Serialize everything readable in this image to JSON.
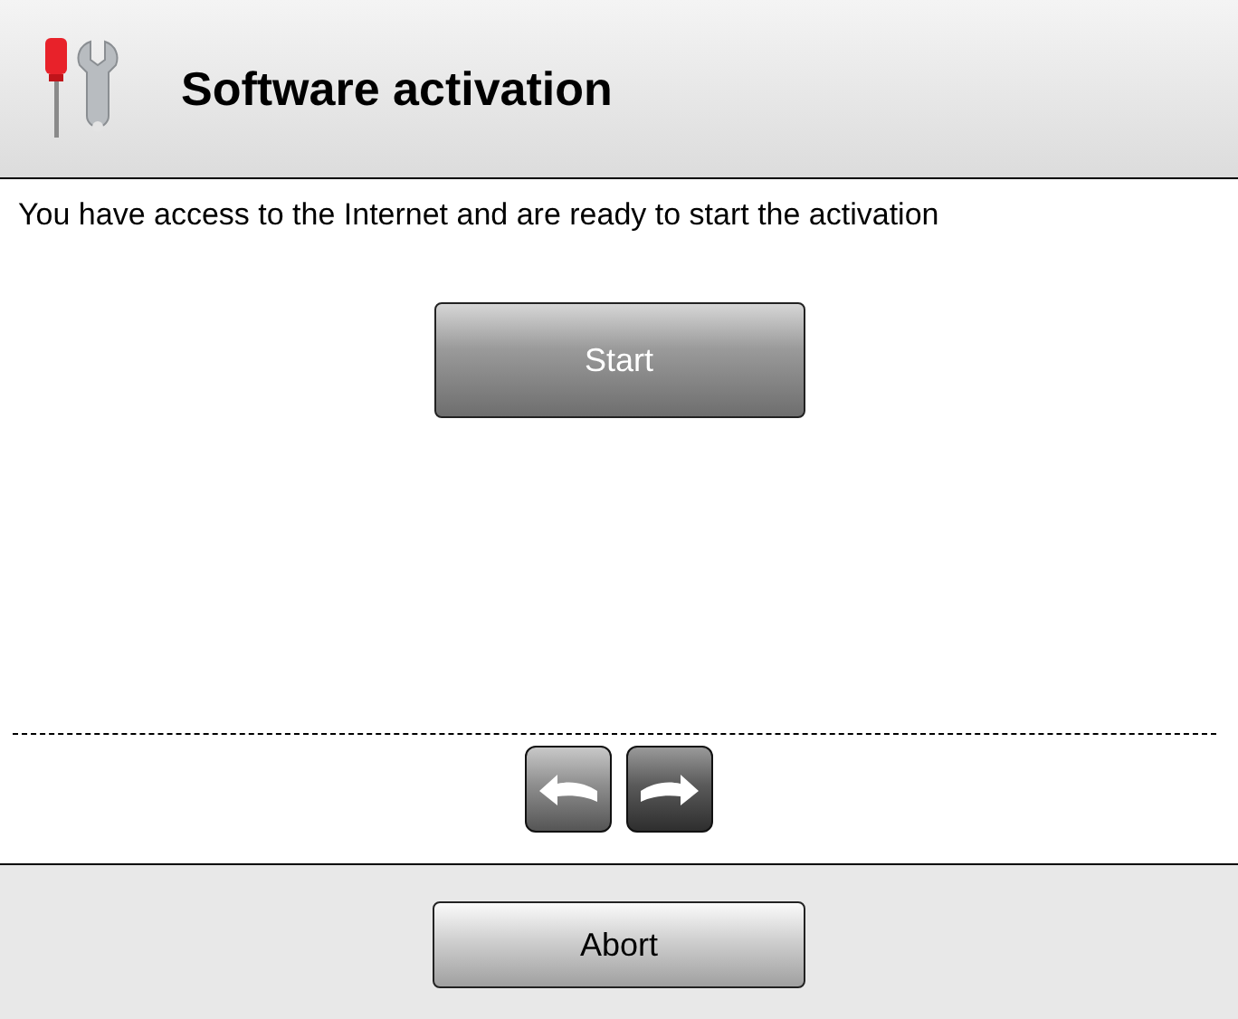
{
  "header": {
    "title": "Software activation"
  },
  "message": "You have access to the Internet and are ready to start the activation",
  "start_button": "Start",
  "nav_buttons": [
    {
      "kind": "back"
    },
    {
      "kind": "forward"
    }
  ],
  "footer": {
    "abort_button": "Abort"
  }
}
